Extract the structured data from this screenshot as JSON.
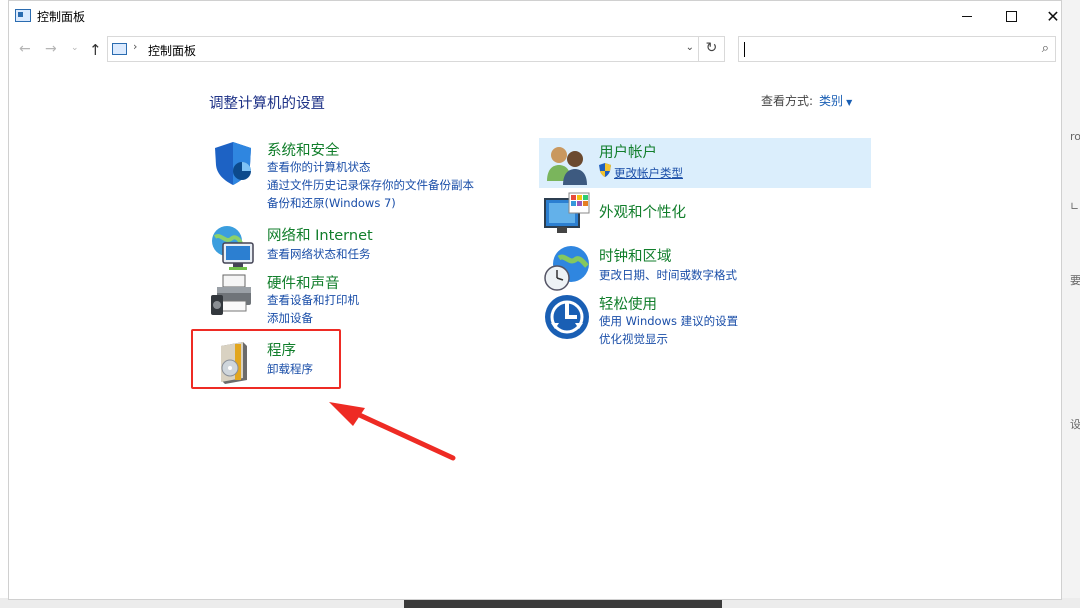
{
  "window": {
    "title": "控制面板",
    "close_glyph": "✕"
  },
  "nav": {
    "back_glyph": "←",
    "forward_glyph": "→",
    "recent_glyph": "⌄",
    "up_glyph": "↑",
    "breadcrumb_sep": "›",
    "breadcrumb": "控制面板",
    "dropdown_glyph": "⌄",
    "refresh_glyph": "↻",
    "search_placeholder": "",
    "search_glyph": "⌕"
  },
  "content": {
    "heading": "调整计算机的设置",
    "view_by_label": "查看方式:",
    "view_by_value": "类别",
    "view_by_arrow": "▼"
  },
  "categories": {
    "system_security": {
      "title": "系统和安全",
      "links": [
        "查看你的计算机状态",
        "通过文件历史记录保存你的文件备份副本",
        "备份和还原(Windows 7)"
      ]
    },
    "network": {
      "title": "网络和 Internet",
      "links": [
        "查看网络状态和任务"
      ]
    },
    "hardware": {
      "title": "硬件和声音",
      "links": [
        "查看设备和打印机",
        "添加设备"
      ]
    },
    "programs": {
      "title": "程序",
      "links": [
        "卸载程序"
      ]
    },
    "user_accounts": {
      "title": "用户帐户",
      "links": [
        "更改帐户类型"
      ]
    },
    "appearance": {
      "title": "外观和个性化",
      "links": []
    },
    "clock_region": {
      "title": "时钟和区域",
      "links": [
        "更改日期、时间或数字格式"
      ]
    },
    "ease_access": {
      "title": "轻松使用",
      "links": [
        "使用 Windows 建议的设置",
        "优化视觉显示"
      ]
    }
  },
  "desktop_edge": [
    "ro",
    "∟",
    "要",
    "设"
  ],
  "colors": {
    "category_title": "#117e2b",
    "link": "#1a4ea8",
    "heading": "#1e3287",
    "highlight": "#dbeefc",
    "annotation_red": "#ee2b24"
  }
}
